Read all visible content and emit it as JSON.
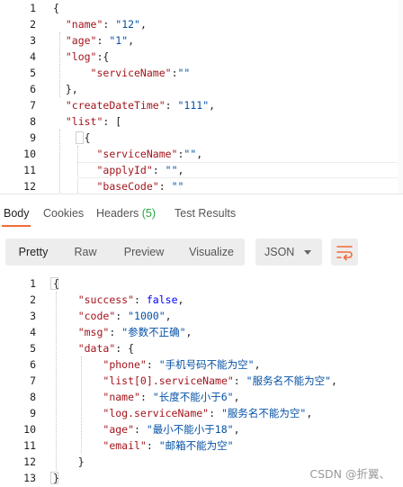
{
  "request_body": {
    "lines": [
      {
        "n": "1",
        "parts": [
          [
            "p",
            "{"
          ]
        ]
      },
      {
        "n": "2",
        "parts": [
          [
            "p",
            "  "
          ],
          [
            "k",
            "\"name\""
          ],
          [
            "p",
            ": "
          ],
          [
            "s",
            "\"12\""
          ],
          [
            "p",
            ","
          ]
        ]
      },
      {
        "n": "3",
        "parts": [
          [
            "p",
            "  "
          ],
          [
            "k",
            "\"age\""
          ],
          [
            "p",
            ": "
          ],
          [
            "s",
            "\"1\""
          ],
          [
            "p",
            ","
          ]
        ]
      },
      {
        "n": "4",
        "parts": [
          [
            "p",
            "  "
          ],
          [
            "k",
            "\"log\""
          ],
          [
            "p",
            ":{"
          ]
        ]
      },
      {
        "n": "5",
        "parts": [
          [
            "p",
            "      "
          ],
          [
            "k",
            "\"serviceName\""
          ],
          [
            "p",
            ":"
          ],
          [
            "s",
            "\"\""
          ]
        ]
      },
      {
        "n": "6",
        "parts": [
          [
            "p",
            "  },"
          ]
        ]
      },
      {
        "n": "7",
        "parts": [
          [
            "p",
            "  "
          ],
          [
            "k",
            "\"createDateTime\""
          ],
          [
            "p",
            ": "
          ],
          [
            "s",
            "\"111\""
          ],
          [
            "p",
            ","
          ]
        ]
      },
      {
        "n": "8",
        "parts": [
          [
            "p",
            "  "
          ],
          [
            "k",
            "\"list\""
          ],
          [
            "p",
            ": ["
          ]
        ]
      },
      {
        "n": "9",
        "parts": [
          [
            "p",
            "     {"
          ]
        ]
      },
      {
        "n": "10",
        "parts": [
          [
            "p",
            "       "
          ],
          [
            "k",
            "\"serviceName\""
          ],
          [
            "p",
            ":"
          ],
          [
            "s",
            "\"\""
          ],
          [
            "p",
            ","
          ]
        ]
      },
      {
        "n": "11",
        "parts": [
          [
            "p",
            "       "
          ],
          [
            "k",
            "\"applyId\""
          ],
          [
            "p",
            ": "
          ],
          [
            "s",
            "\"\""
          ],
          [
            "p",
            ","
          ]
        ]
      },
      {
        "n": "12",
        "parts": [
          [
            "p",
            "       "
          ],
          [
            "k",
            "\"baseCode\""
          ],
          [
            "p",
            ": "
          ],
          [
            "s",
            "\"\""
          ]
        ]
      }
    ]
  },
  "response_tabs": {
    "body": "Body",
    "cookies": "Cookies",
    "headers": "Headers",
    "headers_count": "(5)",
    "test_results": "Test Results"
  },
  "view_modes": {
    "pretty": "Pretty",
    "raw": "Raw",
    "preview": "Preview",
    "visualize": "Visualize",
    "format": "JSON"
  },
  "response_body": {
    "lines": [
      {
        "n": "1",
        "parts": [
          [
            "p",
            "{"
          ]
        ]
      },
      {
        "n": "2",
        "parts": [
          [
            "p",
            "    "
          ],
          [
            "k",
            "\"success\""
          ],
          [
            "p",
            ": "
          ],
          [
            "b",
            "false"
          ],
          [
            "p",
            ","
          ]
        ]
      },
      {
        "n": "3",
        "parts": [
          [
            "p",
            "    "
          ],
          [
            "k",
            "\"code\""
          ],
          [
            "p",
            ": "
          ],
          [
            "s",
            "\"1000\""
          ],
          [
            "p",
            ","
          ]
        ]
      },
      {
        "n": "4",
        "parts": [
          [
            "p",
            "    "
          ],
          [
            "k",
            "\"msg\""
          ],
          [
            "p",
            ": "
          ],
          [
            "s",
            "\"参数不正确\""
          ],
          [
            "p",
            ","
          ]
        ]
      },
      {
        "n": "5",
        "parts": [
          [
            "p",
            "    "
          ],
          [
            "k",
            "\"data\""
          ],
          [
            "p",
            ": {"
          ]
        ]
      },
      {
        "n": "6",
        "parts": [
          [
            "p",
            "        "
          ],
          [
            "k",
            "\"phone\""
          ],
          [
            "p",
            ": "
          ],
          [
            "s",
            "\"手机号码不能为空\""
          ],
          [
            "p",
            ","
          ]
        ]
      },
      {
        "n": "7",
        "parts": [
          [
            "p",
            "        "
          ],
          [
            "k",
            "\"list[0].serviceName\""
          ],
          [
            "p",
            ": "
          ],
          [
            "s",
            "\"服务名不能为空\""
          ],
          [
            "p",
            ","
          ]
        ]
      },
      {
        "n": "8",
        "parts": [
          [
            "p",
            "        "
          ],
          [
            "k",
            "\"name\""
          ],
          [
            "p",
            ": "
          ],
          [
            "s",
            "\"长度不能小于6\""
          ],
          [
            "p",
            ","
          ]
        ]
      },
      {
        "n": "9",
        "parts": [
          [
            "p",
            "        "
          ],
          [
            "k",
            "\"log.serviceName\""
          ],
          [
            "p",
            ": "
          ],
          [
            "s",
            "\"服务名不能为空\""
          ],
          [
            "p",
            ","
          ]
        ]
      },
      {
        "n": "10",
        "parts": [
          [
            "p",
            "        "
          ],
          [
            "k",
            "\"age\""
          ],
          [
            "p",
            ": "
          ],
          [
            "s",
            "\"最小不能小于18\""
          ],
          [
            "p",
            ","
          ]
        ]
      },
      {
        "n": "11",
        "parts": [
          [
            "p",
            "        "
          ],
          [
            "k",
            "\"email\""
          ],
          [
            "p",
            ": "
          ],
          [
            "s",
            "\"邮箱不能为空\""
          ]
        ]
      },
      {
        "n": "12",
        "parts": [
          [
            "p",
            "    }"
          ]
        ]
      },
      {
        "n": "13",
        "parts": [
          [
            "p",
            "}"
          ]
        ]
      }
    ]
  },
  "watermark": "CSDN @折翼、",
  "icons": {
    "format_caret": "chevron-down-icon",
    "wrap": "wrap-lines-icon"
  },
  "colors": {
    "key": "#a3151c",
    "string": "#0451a5",
    "boolean": "#0000ff",
    "accent": "#f26b3a",
    "badge": "#26a544"
  }
}
